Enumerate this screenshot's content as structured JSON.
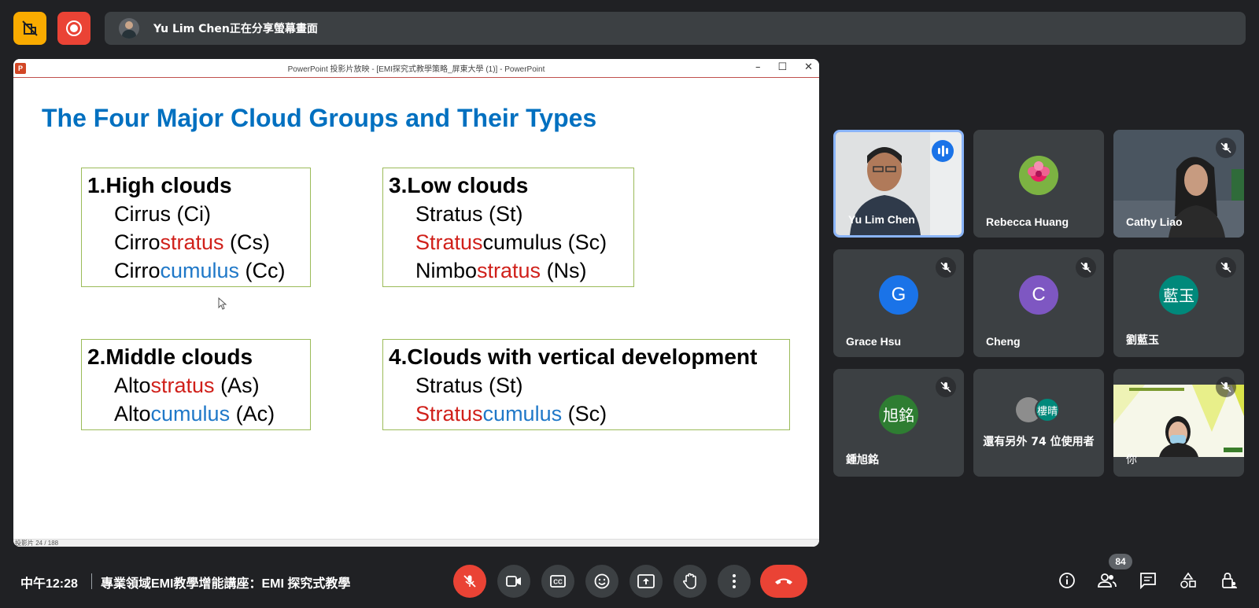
{
  "top": {
    "share_banner": "Yu Lim Chen正在分享螢幕畫面"
  },
  "ppt": {
    "window_title": "PowerPoint 投影片放映 - [EMI探究式教學策略_屏東大學 (1)] - PowerPoint",
    "status_text": "投影片 24 / 188",
    "slide": {
      "title": "The Four Major Cloud Groups and Their Types",
      "groups": [
        {
          "head": "1.High clouds",
          "lines": [
            {
              "a": "Cirrus (Ci)",
              "b": "",
              "c": ""
            },
            {
              "a": "Cirro",
              "b": "stratus",
              "c": " (Cs)"
            },
            {
              "a": "Cirro",
              "b": "cumulus",
              "c": " (Cc)"
            }
          ]
        },
        {
          "head": "2.Middle clouds",
          "lines": [
            {
              "a": "Alto",
              "b": "stratus",
              "c": " (As)"
            },
            {
              "a": "Alto",
              "b": "cumulus",
              "c": " (Ac)"
            }
          ]
        },
        {
          "head": "3.Low clouds",
          "lines": [
            {
              "a": "Stratus (St)",
              "b": "",
              "c": ""
            },
            {
              "a": "Stratus",
              "b": "cumulus",
              "c": " (Sc)"
            },
            {
              "a": "Nimbo",
              "b": "stratus",
              "c": " (Ns)"
            }
          ]
        },
        {
          "head": "4.Clouds with vertical development",
          "lines": [
            {
              "a": "Stratus (St)",
              "b": "",
              "c": ""
            },
            {
              "a": "Stratus",
              "b": "cumulus",
              "c": " (Sc)"
            }
          ]
        }
      ]
    }
  },
  "participants": [
    {
      "name": "Yu Lim Chen"
    },
    {
      "name": "Rebecca Huang"
    },
    {
      "name": "Cathy Liao"
    },
    {
      "name": "Grace Hsu",
      "initial": "G"
    },
    {
      "name": "Cheng",
      "initial": "C"
    },
    {
      "name": "劉藍玉",
      "initial": "藍玉"
    },
    {
      "name": "鍾旭銘",
      "initial": "旭銘"
    },
    {
      "name": "還有另外 74 位使用者",
      "initial": "樓晴"
    },
    {
      "name": "你"
    }
  ],
  "colors": {
    "accent": "#8ab4f8",
    "danger": "#ea4335",
    "warning": "#f9ab00",
    "title_blue": "#0070c0"
  },
  "bottom": {
    "time": "中午12:28",
    "meeting_title": "專業領域EMI教學增能講座：EMI 探究式教學",
    "people_count": "84"
  }
}
